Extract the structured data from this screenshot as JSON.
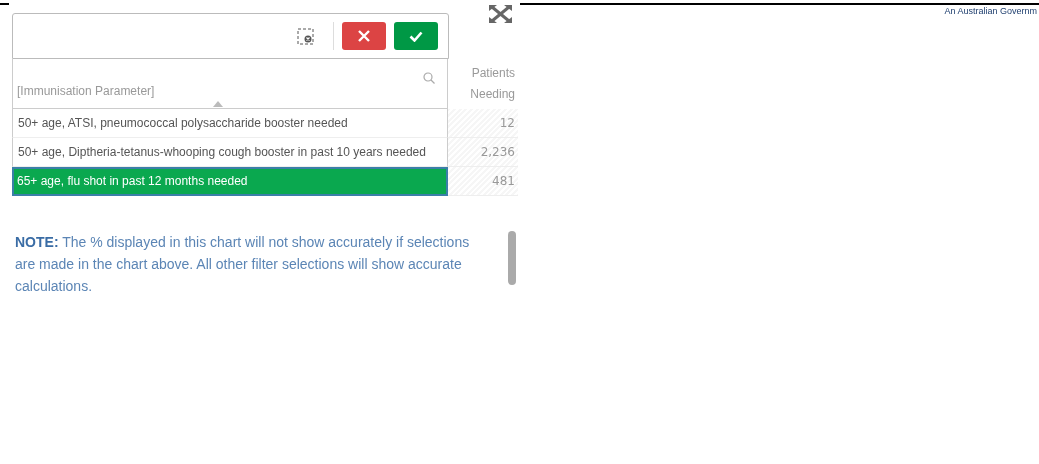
{
  "banner_text": "An Australian Governm",
  "selection_toolbar": {
    "buttons": [
      {
        "kind": "clear"
      },
      {
        "kind": "cancel"
      },
      {
        "kind": "confirm"
      }
    ]
  },
  "table": {
    "columns": [
      {
        "label": "[Immunisation Parameter]"
      },
      {
        "label": "Patients Needing"
      }
    ],
    "rows": [
      {
        "parameter": "50+ age, ATSI, pneumococcal polysaccharide booster needed",
        "patients": "12",
        "selected": false
      },
      {
        "parameter": "50+ age, Diptheria-tetanus-whooping cough booster in past 10 years needed",
        "patients": "2,236",
        "selected": false
      },
      {
        "parameter": "65+ age, flu shot in past 12 months needed",
        "patients": "481",
        "selected": true
      }
    ]
  },
  "note": "**NOTE:** The % displayed in this chart will not show accurately if selections are made in the chart above. All other filter selections will show accurate calculations."
}
